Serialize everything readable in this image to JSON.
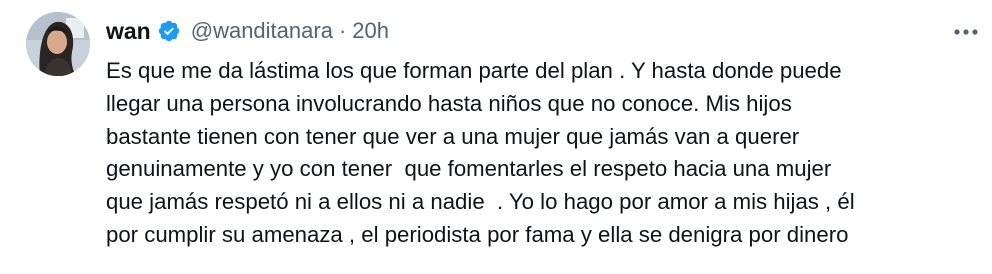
{
  "tweet": {
    "author": {
      "display_name": "wan",
      "verified_icon": "verified-badge-icon",
      "handle": "@wanditanara",
      "separator": "·",
      "timestamp": "20h"
    },
    "more_icon": "more-options-icon",
    "lines": [
      "Es que me da lástima los que forman parte del plan . Y hasta donde puede",
      "llegar una persona involucrando hasta niños que no conoce. Mis hijos",
      "bastante tienen con tener que ver a una mujer que jamás van a querer",
      "genuinamente y yo con tener  que fomentarles el respeto hacia una mujer",
      "que jamás respetó ni a ellos ni a nadie  . Yo lo hago por amor a mis hijas , él",
      "por cumplir su amenaza , el periodista por fama y ella se denigra por dinero"
    ]
  },
  "colors": {
    "text_primary": "#0f1419",
    "text_secondary": "#536471",
    "verified_blue": "#1d9bf0",
    "background": "#ffffff"
  }
}
